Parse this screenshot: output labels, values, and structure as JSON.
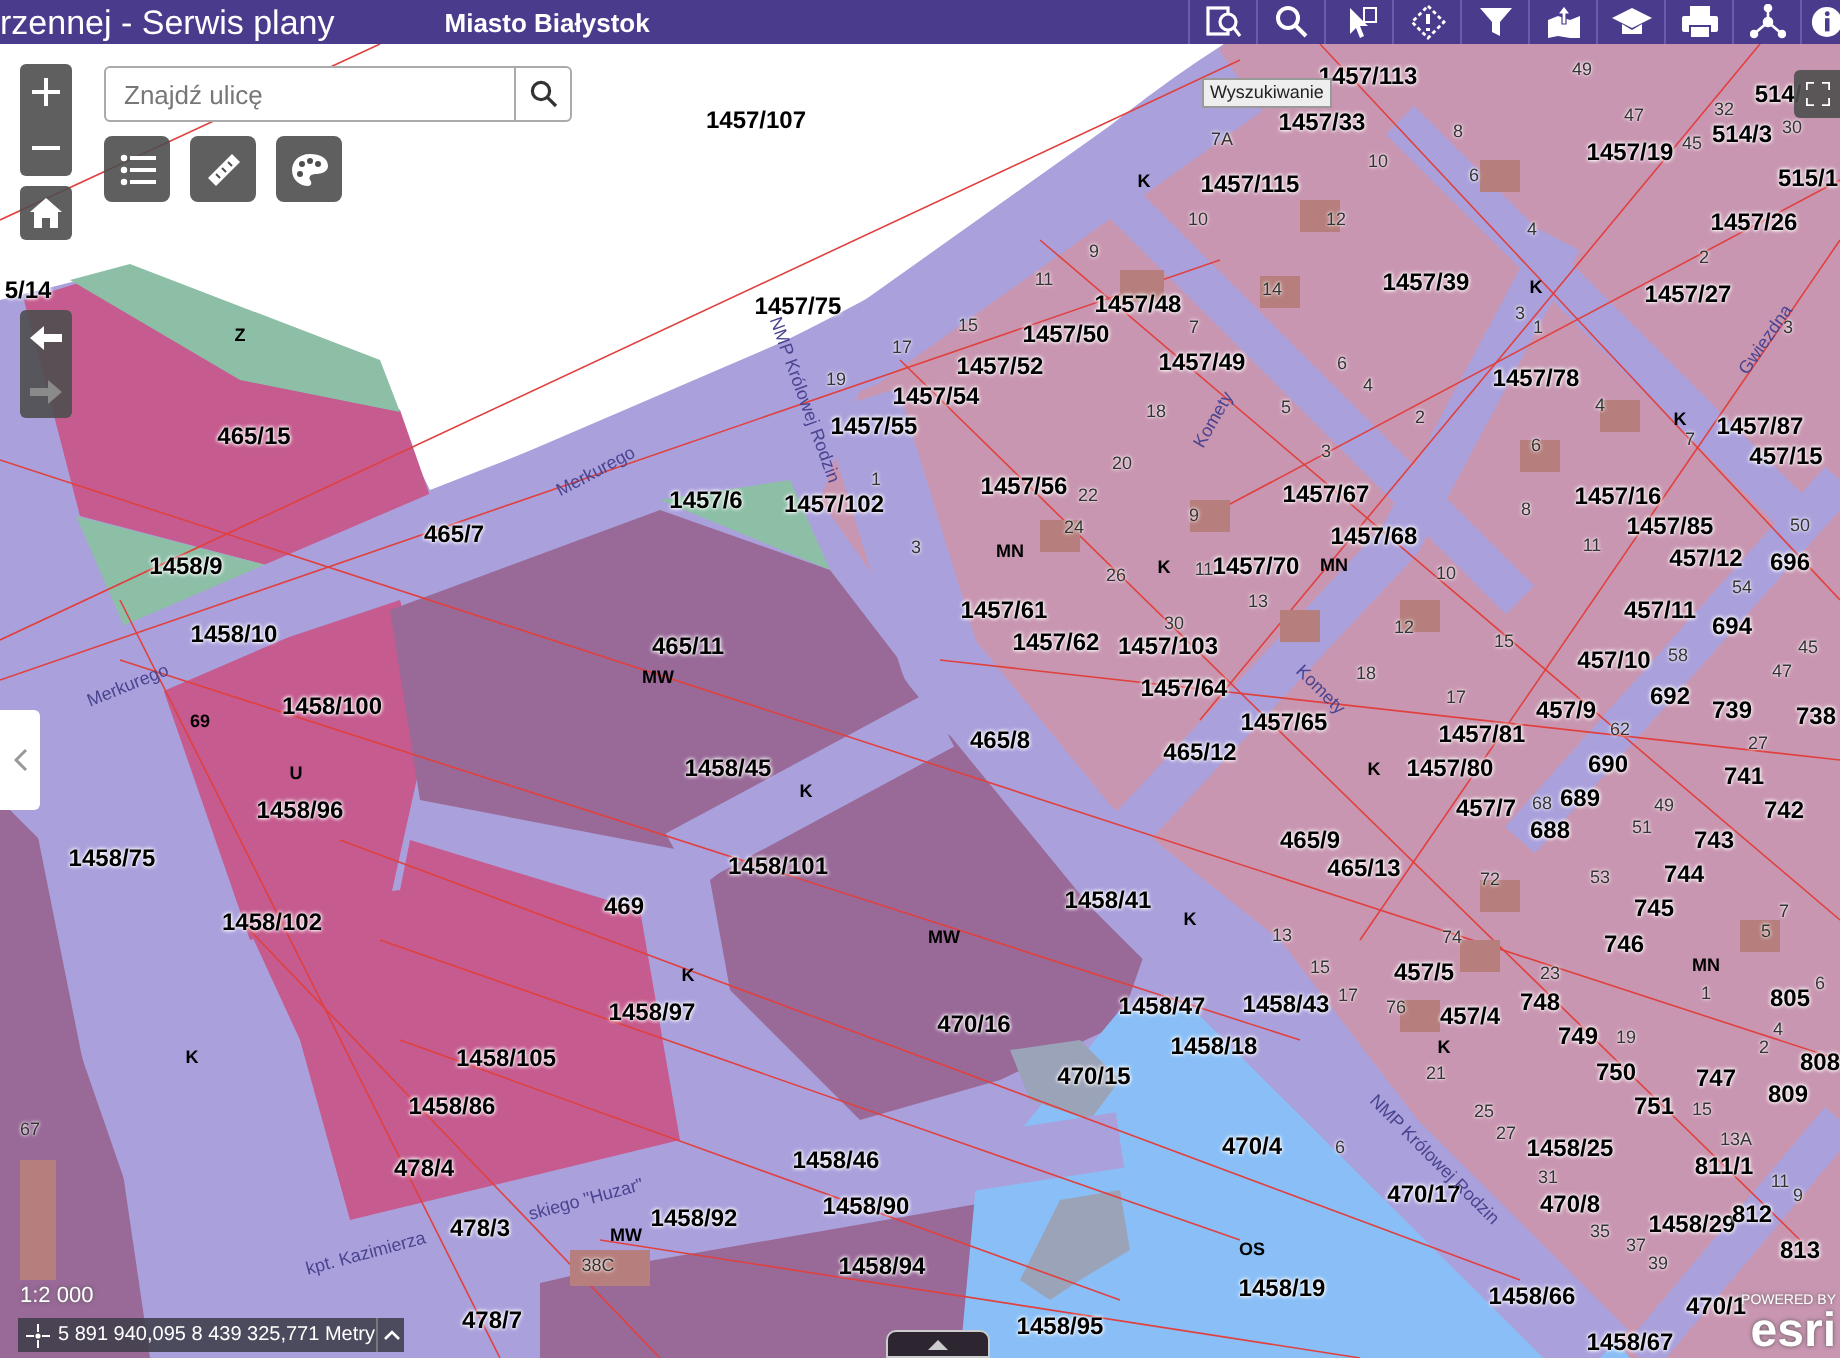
{
  "header": {
    "title": "rzennej - Serwis plany",
    "city": "Miasto Białystok"
  },
  "tooltip": "Wyszukiwanie",
  "search": {
    "placeholder": "Znajdź ulicę"
  },
  "map": {
    "labels": [
      {
        "text": "1457/107",
        "kind": "parcel"
      },
      {
        "text": "5/14",
        "kind": "parcel"
      },
      {
        "text": "1457/75",
        "kind": "parcel"
      },
      {
        "text": "1457/113",
        "kind": "parcel"
      },
      {
        "text": "1457/33",
        "kind": "parcel"
      },
      {
        "text": "1457/115",
        "kind": "parcel"
      },
      {
        "text": "1457/19",
        "kind": "parcel"
      },
      {
        "text": "514/3",
        "kind": "parcel"
      },
      {
        "text": "515/1",
        "kind": "parcel"
      },
      {
        "text": "1457/26",
        "kind": "parcel"
      },
      {
        "text": "1457/27",
        "kind": "parcel"
      },
      {
        "text": "1457/39",
        "kind": "parcel"
      },
      {
        "text": "1457/48",
        "kind": "parcel"
      },
      {
        "text": "1457/50",
        "kind": "parcel"
      },
      {
        "text": "1457/52",
        "kind": "parcel"
      },
      {
        "text": "1457/49",
        "kind": "parcel"
      },
      {
        "text": "1457/54",
        "kind": "parcel"
      },
      {
        "text": "1457/55",
        "kind": "parcel"
      },
      {
        "text": "1457/78",
        "kind": "parcel"
      },
      {
        "text": "1457/87",
        "kind": "parcel"
      },
      {
        "text": "457/15",
        "kind": "parcel"
      },
      {
        "text": "1457/56",
        "kind": "parcel"
      },
      {
        "text": "1457/67",
        "kind": "parcel"
      },
      {
        "text": "1457/68",
        "kind": "parcel"
      },
      {
        "text": "1457/16",
        "kind": "parcel"
      },
      {
        "text": "1457/85",
        "kind": "parcel"
      },
      {
        "text": "457/12",
        "kind": "parcel"
      },
      {
        "text": "1457/70",
        "kind": "parcel"
      },
      {
        "text": "696",
        "kind": "parcel"
      },
      {
        "text": "1457/61",
        "kind": "parcel"
      },
      {
        "text": "1457/62",
        "kind": "parcel"
      },
      {
        "text": "1457/103",
        "kind": "parcel"
      },
      {
        "text": "457/11",
        "kind": "parcel"
      },
      {
        "text": "694",
        "kind": "parcel"
      },
      {
        "text": "1457/64",
        "kind": "parcel"
      },
      {
        "text": "1457/65",
        "kind": "parcel"
      },
      {
        "text": "457/10",
        "kind": "parcel"
      },
      {
        "text": "692",
        "kind": "parcel"
      },
      {
        "text": "739",
        "kind": "parcel"
      },
      {
        "text": "738",
        "kind": "parcel"
      },
      {
        "text": "465/8",
        "kind": "parcel"
      },
      {
        "text": "465/12",
        "kind": "parcel"
      },
      {
        "text": "1457/81",
        "kind": "parcel"
      },
      {
        "text": "457/9",
        "kind": "parcel"
      },
      {
        "text": "690",
        "kind": "parcel"
      },
      {
        "text": "741",
        "kind": "parcel"
      },
      {
        "text": "742",
        "kind": "parcel"
      },
      {
        "text": "1457/80",
        "kind": "parcel"
      },
      {
        "text": "689",
        "kind": "parcel"
      },
      {
        "text": "457/7",
        "kind": "parcel"
      },
      {
        "text": "688",
        "kind": "parcel"
      },
      {
        "text": "743",
        "kind": "parcel"
      },
      {
        "text": "744",
        "kind": "parcel"
      },
      {
        "text": "745",
        "kind": "parcel"
      },
      {
        "text": "746",
        "kind": "parcel"
      },
      {
        "text": "465/9",
        "kind": "parcel"
      },
      {
        "text": "465/13",
        "kind": "parcel"
      },
      {
        "text": "1458/41",
        "kind": "parcel"
      },
      {
        "text": "470/16",
        "kind": "parcel"
      },
      {
        "text": "1458/47",
        "kind": "parcel"
      },
      {
        "text": "1458/43",
        "kind": "parcel"
      },
      {
        "text": "457/5",
        "kind": "parcel"
      },
      {
        "text": "457/4",
        "kind": "parcel"
      },
      {
        "text": "748",
        "kind": "parcel"
      },
      {
        "text": "749",
        "kind": "parcel"
      },
      {
        "text": "750",
        "kind": "parcel"
      },
      {
        "text": "751",
        "kind": "parcel"
      },
      {
        "text": "747",
        "kind": "parcel"
      },
      {
        "text": "805",
        "kind": "parcel"
      },
      {
        "text": "809",
        "kind": "parcel"
      },
      {
        "text": "808",
        "kind": "parcel"
      },
      {
        "text": "1458/18",
        "kind": "parcel"
      },
      {
        "text": "470/15",
        "kind": "parcel"
      },
      {
        "text": "470/4",
        "kind": "parcel"
      },
      {
        "text": "470/17",
        "kind": "parcel"
      },
      {
        "text": "1458/25",
        "kind": "parcel"
      },
      {
        "text": "811/1",
        "kind": "parcel"
      },
      {
        "text": "470/8",
        "kind": "parcel"
      },
      {
        "text": "1458/29",
        "kind": "parcel"
      },
      {
        "text": "812",
        "kind": "parcel"
      },
      {
        "text": "813",
        "kind": "parcel"
      },
      {
        "text": "1458/19",
        "kind": "parcel"
      },
      {
        "text": "1458/66",
        "kind": "parcel"
      },
      {
        "text": "470/1",
        "kind": "parcel"
      },
      {
        "text": "1458/67",
        "kind": "parcel"
      },
      {
        "text": "1458/95",
        "kind": "parcel"
      },
      {
        "text": "465/15",
        "kind": "parcel"
      },
      {
        "text": "465/7",
        "kind": "parcel"
      },
      {
        "text": "1457/6",
        "kind": "parcel"
      },
      {
        "text": "1457/102",
        "kind": "parcel"
      },
      {
        "text": "1458/9",
        "kind": "parcel"
      },
      {
        "text": "1458/10",
        "kind": "parcel"
      },
      {
        "text": "465/11",
        "kind": "parcel"
      },
      {
        "text": "1458/100",
        "kind": "parcel"
      },
      {
        "text": "1458/45",
        "kind": "parcel"
      },
      {
        "text": "1458/96",
        "kind": "parcel"
      },
      {
        "text": "1458/101",
        "kind": "parcel"
      },
      {
        "text": "1458/75",
        "kind": "parcel"
      },
      {
        "text": "469",
        "kind": "parcel"
      },
      {
        "text": "1458/102",
        "kind": "parcel"
      },
      {
        "text": "1458/97",
        "kind": "parcel"
      },
      {
        "text": "1458/105",
        "kind": "parcel"
      },
      {
        "text": "1458/86",
        "kind": "parcel"
      },
      {
        "text": "478/4",
        "kind": "parcel"
      },
      {
        "text": "1458/46",
        "kind": "parcel"
      },
      {
        "text": "1458/90",
        "kind": "parcel"
      },
      {
        "text": "478/3",
        "kind": "parcel"
      },
      {
        "text": "1458/92",
        "kind": "parcel"
      },
      {
        "text": "1458/94",
        "kind": "parcel"
      },
      {
        "text": "478/7",
        "kind": "parcel"
      },
      {
        "text": "514/",
        "kind": "parcel"
      },
      {
        "text": "Z",
        "kind": "zone"
      },
      {
        "text": "MW",
        "kind": "zone"
      },
      {
        "text": "U",
        "kind": "zone"
      },
      {
        "text": "69",
        "kind": "zone"
      },
      {
        "text": "K",
        "kind": "zone"
      },
      {
        "text": "MN",
        "kind": "zone"
      },
      {
        "text": "K",
        "kind": "zone"
      },
      {
        "text": "K",
        "kind": "zone"
      },
      {
        "text": "K",
        "kind": "zone"
      },
      {
        "text": "K",
        "kind": "zone"
      },
      {
        "text": "K",
        "kind": "zone"
      },
      {
        "text": "MW",
        "kind": "zone"
      },
      {
        "text": "K",
        "kind": "zone"
      },
      {
        "text": "K",
        "kind": "zone"
      },
      {
        "text": "K",
        "kind": "zone"
      },
      {
        "text": "MW",
        "kind": "zone"
      },
      {
        "text": "OS",
        "kind": "zone"
      },
      {
        "text": "MN",
        "kind": "zone"
      },
      {
        "text": "K",
        "kind": "zone"
      },
      {
        "text": "MN",
        "kind": "zone"
      },
      {
        "text": "9",
        "kind": "house"
      },
      {
        "text": "11",
        "kind": "house"
      },
      {
        "text": "15",
        "kind": "house"
      },
      {
        "text": "17",
        "kind": "house"
      },
      {
        "text": "19",
        "kind": "house"
      },
      {
        "text": "7",
        "kind": "house"
      },
      {
        "text": "18",
        "kind": "house"
      },
      {
        "text": "20",
        "kind": "house"
      },
      {
        "text": "22",
        "kind": "house"
      },
      {
        "text": "24",
        "kind": "house"
      },
      {
        "text": "26",
        "kind": "house"
      },
      {
        "text": "30",
        "kind": "house"
      },
      {
        "text": "1",
        "kind": "house"
      },
      {
        "text": "3",
        "kind": "house"
      },
      {
        "text": "5",
        "kind": "house"
      },
      {
        "text": "3",
        "kind": "house"
      },
      {
        "text": "9",
        "kind": "house"
      },
      {
        "text": "11",
        "kind": "house"
      },
      {
        "text": "13",
        "kind": "house"
      },
      {
        "text": "10",
        "kind": "house"
      },
      {
        "text": "12",
        "kind": "house"
      },
      {
        "text": "18",
        "kind": "house"
      },
      {
        "text": "14",
        "kind": "house"
      },
      {
        "text": "6",
        "kind": "house"
      },
      {
        "text": "4",
        "kind": "house"
      },
      {
        "text": "2",
        "kind": "house"
      },
      {
        "text": "3",
        "kind": "house"
      },
      {
        "text": "1",
        "kind": "house"
      },
      {
        "text": "4",
        "kind": "house"
      },
      {
        "text": "6",
        "kind": "house"
      },
      {
        "text": "8",
        "kind": "house"
      },
      {
        "text": "7",
        "kind": "house"
      },
      {
        "text": "11",
        "kind": "house"
      },
      {
        "text": "15",
        "kind": "house"
      },
      {
        "text": "17",
        "kind": "house"
      },
      {
        "text": "50",
        "kind": "house"
      },
      {
        "text": "54",
        "kind": "house"
      },
      {
        "text": "58",
        "kind": "house"
      },
      {
        "text": "62",
        "kind": "house"
      },
      {
        "text": "45",
        "kind": "house"
      },
      {
        "text": "47",
        "kind": "house"
      },
      {
        "text": "27",
        "kind": "house"
      },
      {
        "text": "2",
        "kind": "house"
      },
      {
        "text": "3",
        "kind": "house"
      },
      {
        "text": "49",
        "kind": "house"
      },
      {
        "text": "47",
        "kind": "house"
      },
      {
        "text": "45",
        "kind": "house"
      },
      {
        "text": "32",
        "kind": "house"
      },
      {
        "text": "30",
        "kind": "house"
      },
      {
        "text": "7A",
        "kind": "house"
      },
      {
        "text": "10",
        "kind": "house"
      },
      {
        "text": "10",
        "kind": "house"
      },
      {
        "text": "12",
        "kind": "house"
      },
      {
        "text": "8",
        "kind": "house"
      },
      {
        "text": "6",
        "kind": "house"
      },
      {
        "text": "4",
        "kind": "house"
      },
      {
        "text": "68",
        "kind": "house"
      },
      {
        "text": "49",
        "kind": "house"
      },
      {
        "text": "51",
        "kind": "house"
      },
      {
        "text": "72",
        "kind": "house"
      },
      {
        "text": "53",
        "kind": "house"
      },
      {
        "text": "13",
        "kind": "house"
      },
      {
        "text": "74",
        "kind": "house"
      },
      {
        "text": "15",
        "kind": "house"
      },
      {
        "text": "17",
        "kind": "house"
      },
      {
        "text": "76",
        "kind": "house"
      },
      {
        "text": "23",
        "kind": "house"
      },
      {
        "text": "19",
        "kind": "house"
      },
      {
        "text": "21",
        "kind": "house"
      },
      {
        "text": "25",
        "kind": "house"
      },
      {
        "text": "27",
        "kind": "house"
      },
      {
        "text": "31",
        "kind": "house"
      },
      {
        "text": "35",
        "kind": "house"
      },
      {
        "text": "37",
        "kind": "house"
      },
      {
        "text": "39",
        "kind": "house"
      },
      {
        "text": "15",
        "kind": "house"
      },
      {
        "text": "13A",
        "kind": "house"
      },
      {
        "text": "11",
        "kind": "house"
      },
      {
        "text": "9",
        "kind": "house"
      },
      {
        "text": "7",
        "kind": "house"
      },
      {
        "text": "5",
        "kind": "house"
      },
      {
        "text": "1",
        "kind": "house"
      },
      {
        "text": "6",
        "kind": "house"
      },
      {
        "text": "4",
        "kind": "house"
      },
      {
        "text": "2",
        "kind": "house"
      },
      {
        "text": "6",
        "kind": "house"
      },
      {
        "text": "67",
        "kind": "house"
      },
      {
        "text": "38C",
        "kind": "house"
      },
      {
        "text": "Merkurego",
        "kind": "street"
      },
      {
        "text": "Merkurego",
        "kind": "street"
      },
      {
        "text": "Komety",
        "kind": "street"
      },
      {
        "text": "Komety",
        "kind": "street"
      },
      {
        "text": "NMP Królowej Rodzin",
        "kind": "street"
      },
      {
        "text": "NMP Królowej Rodzin",
        "kind": "street"
      },
      {
        "text": "Gwiezdna",
        "kind": "street"
      },
      {
        "text": "kpt. Kazimierza",
        "kind": "street"
      },
      {
        "text": "skiego \"Huzar\"",
        "kind": "street"
      }
    ]
  },
  "scale": "1:2 000",
  "coordinates": "5 891 940,095 8 439 325,771 Metry",
  "attribution": {
    "prefix": "POWERED BY",
    "logo": "esri"
  }
}
